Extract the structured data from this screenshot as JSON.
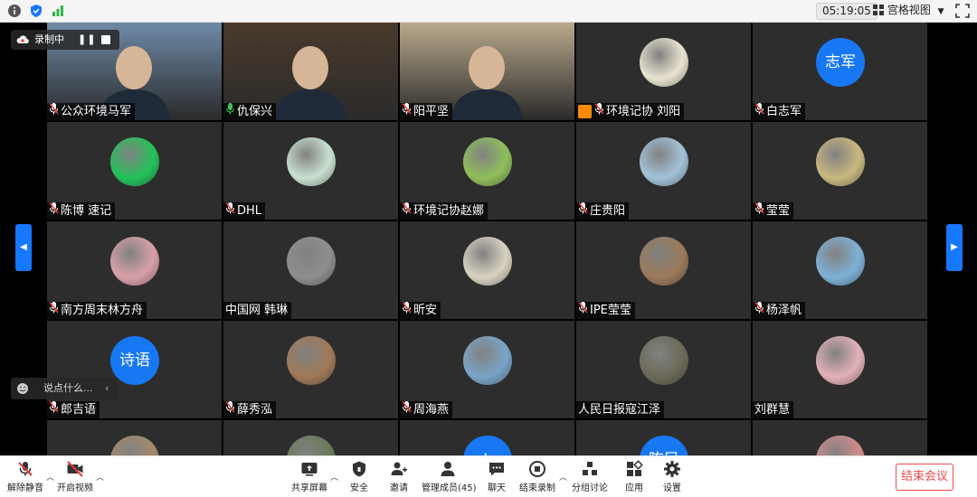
{
  "topbar": {
    "timer": "05:19:05",
    "view_label": "宫格视图",
    "icons": [
      "info-icon",
      "shield-icon",
      "signal-icon",
      "fullscreen-icon"
    ]
  },
  "recording": {
    "label": "录制中"
  },
  "chat": {
    "label": "说点什么",
    "placeholder": "说点什么..."
  },
  "participants": [
    {
      "name": "公众环境马军",
      "muted": true,
      "kind": "video",
      "bg": "#6f8aa8"
    },
    {
      "name": "仇保兴",
      "muted": false,
      "kind": "video",
      "bg": "#4a3a2c",
      "active": true
    },
    {
      "name": "阳平坚",
      "muted": true,
      "kind": "video",
      "bg": "#b9a98c"
    },
    {
      "name": "环境记协 刘阳",
      "muted": true,
      "kind": "photo",
      "bg": "#e9e3d0",
      "host": true
    },
    {
      "name": "白志军",
      "muted": true,
      "kind": "text",
      "avatar_text": "志军"
    },
    {
      "name": "陈博 速记",
      "muted": true,
      "kind": "photo",
      "bg": "#23c25a"
    },
    {
      "name": "DHL",
      "muted": true,
      "kind": "photo",
      "bg": "#c9e0d0"
    },
    {
      "name": "环境记协赵娜",
      "muted": true,
      "kind": "photo",
      "bg": "#8fbf5a"
    },
    {
      "name": "庄贵阳",
      "muted": true,
      "kind": "photo",
      "bg": "#a3c2d8"
    },
    {
      "name": "莹莹",
      "muted": true,
      "kind": "photo",
      "bg": "#c9b880"
    },
    {
      "name": "南方周末林方舟",
      "muted": true,
      "kind": "photo",
      "bg": "#d9a0a8"
    },
    {
      "name": "中国网 韩琳",
      "muted": false,
      "kind": "photo",
      "bg": "#8e8e8e"
    },
    {
      "name": "昕安",
      "muted": true,
      "kind": "photo",
      "bg": "#d8d2c0"
    },
    {
      "name": "IPE莹莹",
      "muted": true,
      "kind": "photo",
      "bg": "#9b7a5a"
    },
    {
      "name": "杨泽帆",
      "muted": true,
      "kind": "photo",
      "bg": "#7db1d6"
    },
    {
      "name": "郎吉语",
      "muted": true,
      "kind": "text",
      "avatar_text": "诗语"
    },
    {
      "name": "薛秀泓",
      "muted": true,
      "kind": "photo",
      "bg": "#a07a58"
    },
    {
      "name": "周海燕",
      "muted": true,
      "kind": "photo",
      "bg": "#7aa4c8"
    },
    {
      "name": "人民日报寇江泽",
      "muted": false,
      "kind": "photo",
      "bg": "#6b6a58"
    },
    {
      "name": "刘群慧",
      "muted": false,
      "kind": "photo",
      "bg": "#e2b1b8"
    },
    {
      "name": "",
      "muted": false,
      "kind": "photo",
      "bg": "#a38a6a"
    },
    {
      "name": "",
      "muted": false,
      "kind": "photo",
      "bg": "#6a7a58"
    },
    {
      "name": "",
      "muted": false,
      "kind": "text",
      "avatar_text": "L"
    },
    {
      "name": "",
      "muted": false,
      "kind": "text",
      "avatar_text": "陈民"
    },
    {
      "name": "",
      "muted": false,
      "kind": "photo",
      "bg": "#d28a8a"
    }
  ],
  "toolbar": {
    "unmute": "解除静音",
    "start_video": "开启视频",
    "share": "共享屏幕",
    "security": "安全",
    "invite": "邀请",
    "manage": "管理成员(45)",
    "chat": "聊天",
    "end_record": "结束录制",
    "breakout": "分组讨论",
    "apps": "应用",
    "settings": "设置",
    "end_meeting": "结束会议"
  },
  "colors": {
    "accent": "#1677ff",
    "end": "#f04848",
    "active_speaker": "#3fbf5b",
    "avatar_blue": "#1878f3"
  }
}
